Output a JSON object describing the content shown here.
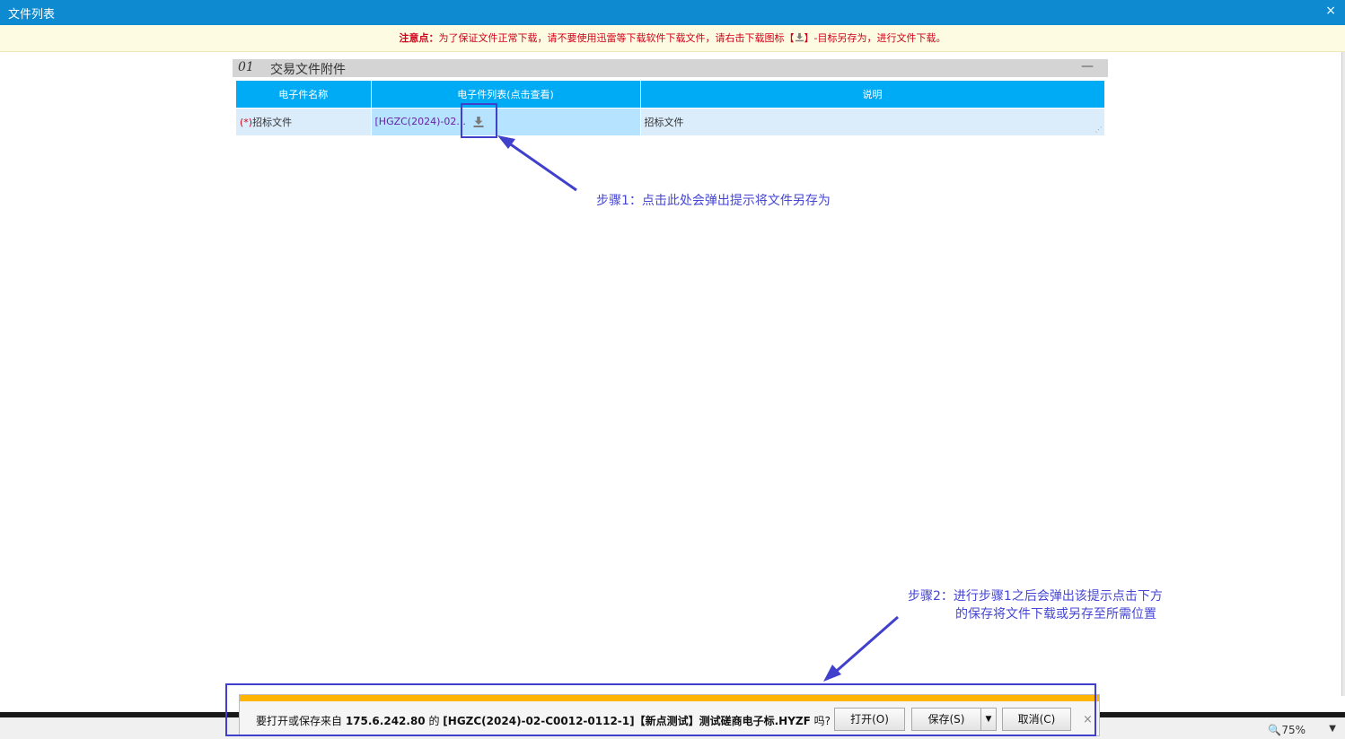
{
  "window": {
    "title": "文件列表",
    "close_glyph": "×"
  },
  "notice": {
    "prefix": "注意点：",
    "text": "为了保证文件正常下载，请不要使用迅雷等下载软件下载文件，请右击下载图标【",
    "suffix": "】-目标另存为，进行文件下载。"
  },
  "section": {
    "number": "01",
    "title": "交易文件附件",
    "collapse_glyph": "—"
  },
  "table": {
    "headers": [
      "电子件名称",
      "电子件列表(点击查看)",
      "说明"
    ],
    "rows": [
      {
        "required_mark": "(*)",
        "name": "招标文件",
        "file_link": "[HGZC(2024)-02...",
        "description": "招标文件"
      }
    ]
  },
  "annotations": {
    "step1": "步骤1：点击此处会弹出提示将文件另存为",
    "step2_line1": "步骤2：进行步骤1之后会弹出该提示点击下方",
    "step2_line2": "的保存将文件下载或另存至所需位置"
  },
  "download_bar": {
    "text_before": "要打开或保存来自 ",
    "host": "175.6.242.80",
    "text_mid": " 的 ",
    "filename": "[HGZC(2024)-02-C0012-0112-1]【新点测试】测试磋商电子标.HYZF",
    "text_after": " 吗?",
    "open_label": "打开(O)",
    "save_label": "保存(S)",
    "save_dropdown_glyph": "▼",
    "cancel_label": "取消(C)",
    "close_glyph": "×"
  },
  "status_bar": {
    "zoom": "75%",
    "zoom_dropdown_glyph": "▼"
  },
  "colors": {
    "title_bar": "#0e8bd0",
    "table_header": "#00abf5",
    "annotation": "#4646d4",
    "download_stripe": "#ffb400"
  },
  "icons": [
    "download-icon",
    "zoom-icon",
    "close-icon"
  ]
}
